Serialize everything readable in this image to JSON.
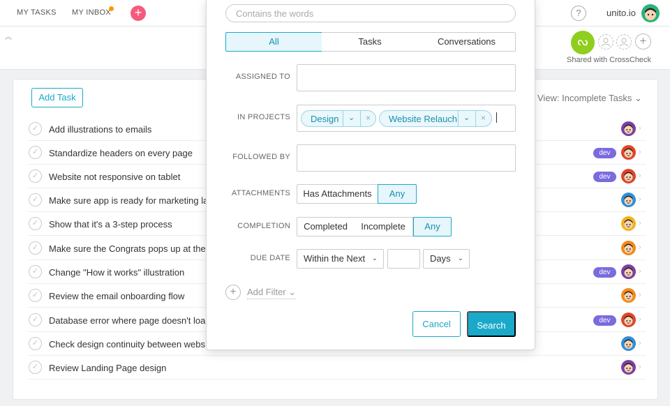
{
  "topbar": {
    "my_tasks": "MY TASKS",
    "my_inbox": "MY INBOX",
    "add": "+",
    "help": "?",
    "brand": "unito.io"
  },
  "subhead": {
    "collapse": "︽",
    "crosscheck_logo": "ᔓ",
    "add": "+",
    "shared_label": "Shared with CrossCheck"
  },
  "tasks_panel": {
    "add_task": "Add Task",
    "view": "View: Incomplete Tasks ⌄",
    "check_glyph": "✓",
    "chevron": "›",
    "rows": [
      {
        "title": "Add illustrations to emails",
        "tag": "",
        "avatar_color": "#7b3fa8"
      },
      {
        "title": "Standardize headers on every page",
        "tag": "dev",
        "avatar_color": "#e0452b"
      },
      {
        "title": "Website not responsive on tablet",
        "tag": "dev",
        "avatar_color": "#e0452b"
      },
      {
        "title": "Make sure app is ready for marketing la",
        "tag": "",
        "avatar_color": "#2f8fd8"
      },
      {
        "title": "Show that it's a 3-step process",
        "tag": "",
        "avatar_color": "#f2b31d"
      },
      {
        "title": "Make sure the Congrats pops up at the",
        "tag": "",
        "avatar_color": "#f28a1d"
      },
      {
        "title": "Change \"How it works\" illustration",
        "tag": "dev",
        "avatar_color": "#7b3fa8"
      },
      {
        "title": "Review the email onboarding flow",
        "tag": "",
        "avatar_color": "#f28a1d"
      },
      {
        "title": "Database error where page doesn't loa",
        "tag": "dev",
        "avatar_color": "#e0452b"
      },
      {
        "title": "Check design continuity between webs",
        "tag": "",
        "avatar_color": "#2f8fd8"
      },
      {
        "title": "Review Landing Page design",
        "tag": "",
        "avatar_color": "#7b3fa8"
      }
    ]
  },
  "filter": {
    "words_placeholder": "Contains the words",
    "tabs": {
      "all": "All",
      "tasks": "Tasks",
      "conversations": "Conversations"
    },
    "assigned_to": "ASSIGNED TO",
    "in_projects": "IN PROJECTS",
    "projects": [
      {
        "name": "Design",
        "drop": "⌄",
        "remove": "×"
      },
      {
        "name": "Website Relauch",
        "drop": "⌄",
        "remove": "×"
      }
    ],
    "followed_by": "FOLLOWED BY",
    "attachments": {
      "label": "ATTACHMENTS",
      "has": "Has Attachments",
      "any": "Any"
    },
    "completion": {
      "label": "COMPLETION",
      "completed": "Completed",
      "incomplete": "Incomplete",
      "any": "Any"
    },
    "due_date": {
      "label": "DUE DATE",
      "range": "Within the Next",
      "amount": "",
      "unit": "Days",
      "caret": "⌄"
    },
    "add_filter_icon": "+",
    "add_filter": "Add Filter ⌄",
    "cancel": "Cancel",
    "search": "Search"
  },
  "colors": {
    "accent": "#1aa9c9",
    "tag_dev": "#7a6bde",
    "crosscheck": "#8fce1e",
    "inbox_dot": "#ff9800",
    "add_button": "#f55a7c"
  }
}
